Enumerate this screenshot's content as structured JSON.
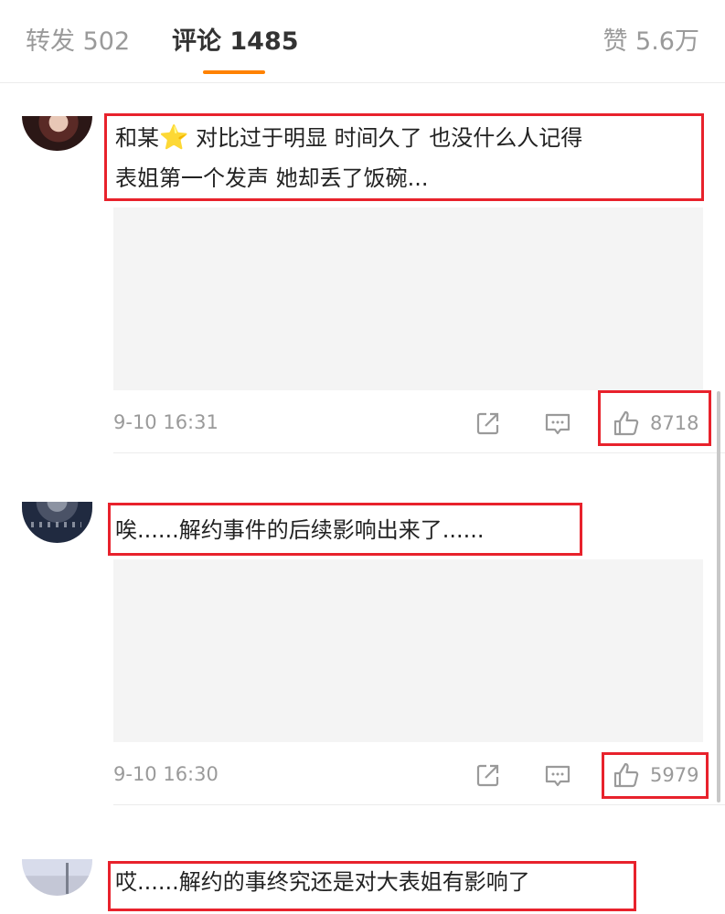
{
  "tabs": {
    "repost": "转发 502",
    "comments": "评论 1485",
    "likes": "赞 5.6万"
  },
  "colors": {
    "accent": "#ff8200",
    "highlight_box": "#e8222c",
    "meta_text": "#9a9a9a"
  },
  "comments": [
    {
      "text_before_emoji": "和某",
      "emoji": "⭐",
      "text_line1_after_emoji": " 对比过于明显  时间久了  也没什么人记得",
      "text_line2": "表姐第一个发声  她却丢了饭碗...",
      "time": "9-10 16:31",
      "like_count": "8718",
      "icons": [
        "share-icon",
        "comment-icon",
        "like-icon"
      ]
    },
    {
      "text": "唉......解约事件的后续影响出来了......",
      "time": "9-10 16:30",
      "like_count": "5979",
      "icons": [
        "share-icon",
        "comment-icon",
        "like-icon"
      ]
    },
    {
      "text": "哎......解约的事终究还是对大表姐有影响了"
    }
  ]
}
